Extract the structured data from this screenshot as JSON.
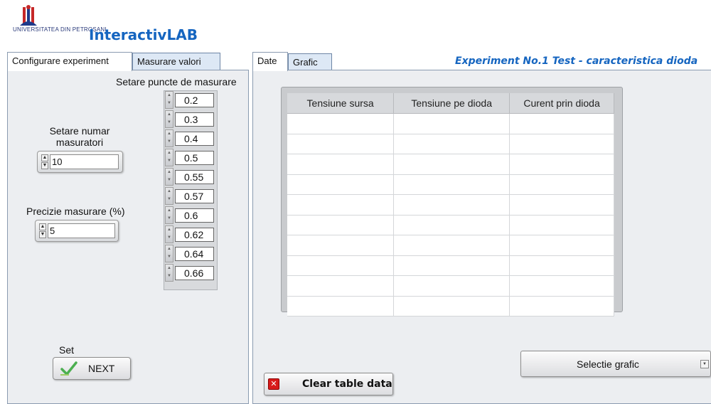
{
  "header": {
    "logo_text": "UNIVERSITATEA DIN PETROȘANI",
    "app_title": "InteractivLAB"
  },
  "left_tabs": [
    {
      "label": "Configurare experiment"
    },
    {
      "label": "Masurare valori"
    }
  ],
  "right_tabs": [
    {
      "label": "Date"
    },
    {
      "label": "Grafic"
    }
  ],
  "experiment_title": "Experiment No.1 Test - caracteristica dioda",
  "config": {
    "setpoints_label": "Setare puncte de masurare",
    "setpoints": [
      "0.2",
      "0.3",
      "0.4",
      "0.5",
      "0.55",
      "0.57",
      "0.6",
      "0.62",
      "0.64",
      "0.66"
    ],
    "num_measurements_label_line1": "Setare numar",
    "num_measurements_label_line2": "masuratori",
    "num_measurements_value": "10",
    "precision_label": "Precizie masurare (%)",
    "precision_value": "5",
    "set_label": "Set",
    "next_label": "NEXT"
  },
  "table": {
    "headers": [
      "Tensiune sursa",
      "Tensiune pe dioda",
      "Curent prin dioda"
    ]
  },
  "buttons": {
    "clear_table_label": "Clear table data",
    "select_chart_label": "Selectie grafic"
  },
  "colors": {
    "accent": "#1565c0",
    "clear_icon": "#d81b1b",
    "check_icon": "#4caf50"
  },
  "icons": {
    "logo": "university-logo",
    "next": "checkmark-icon",
    "clear": "close-icon",
    "dropdown": "chevron-down-icon"
  }
}
